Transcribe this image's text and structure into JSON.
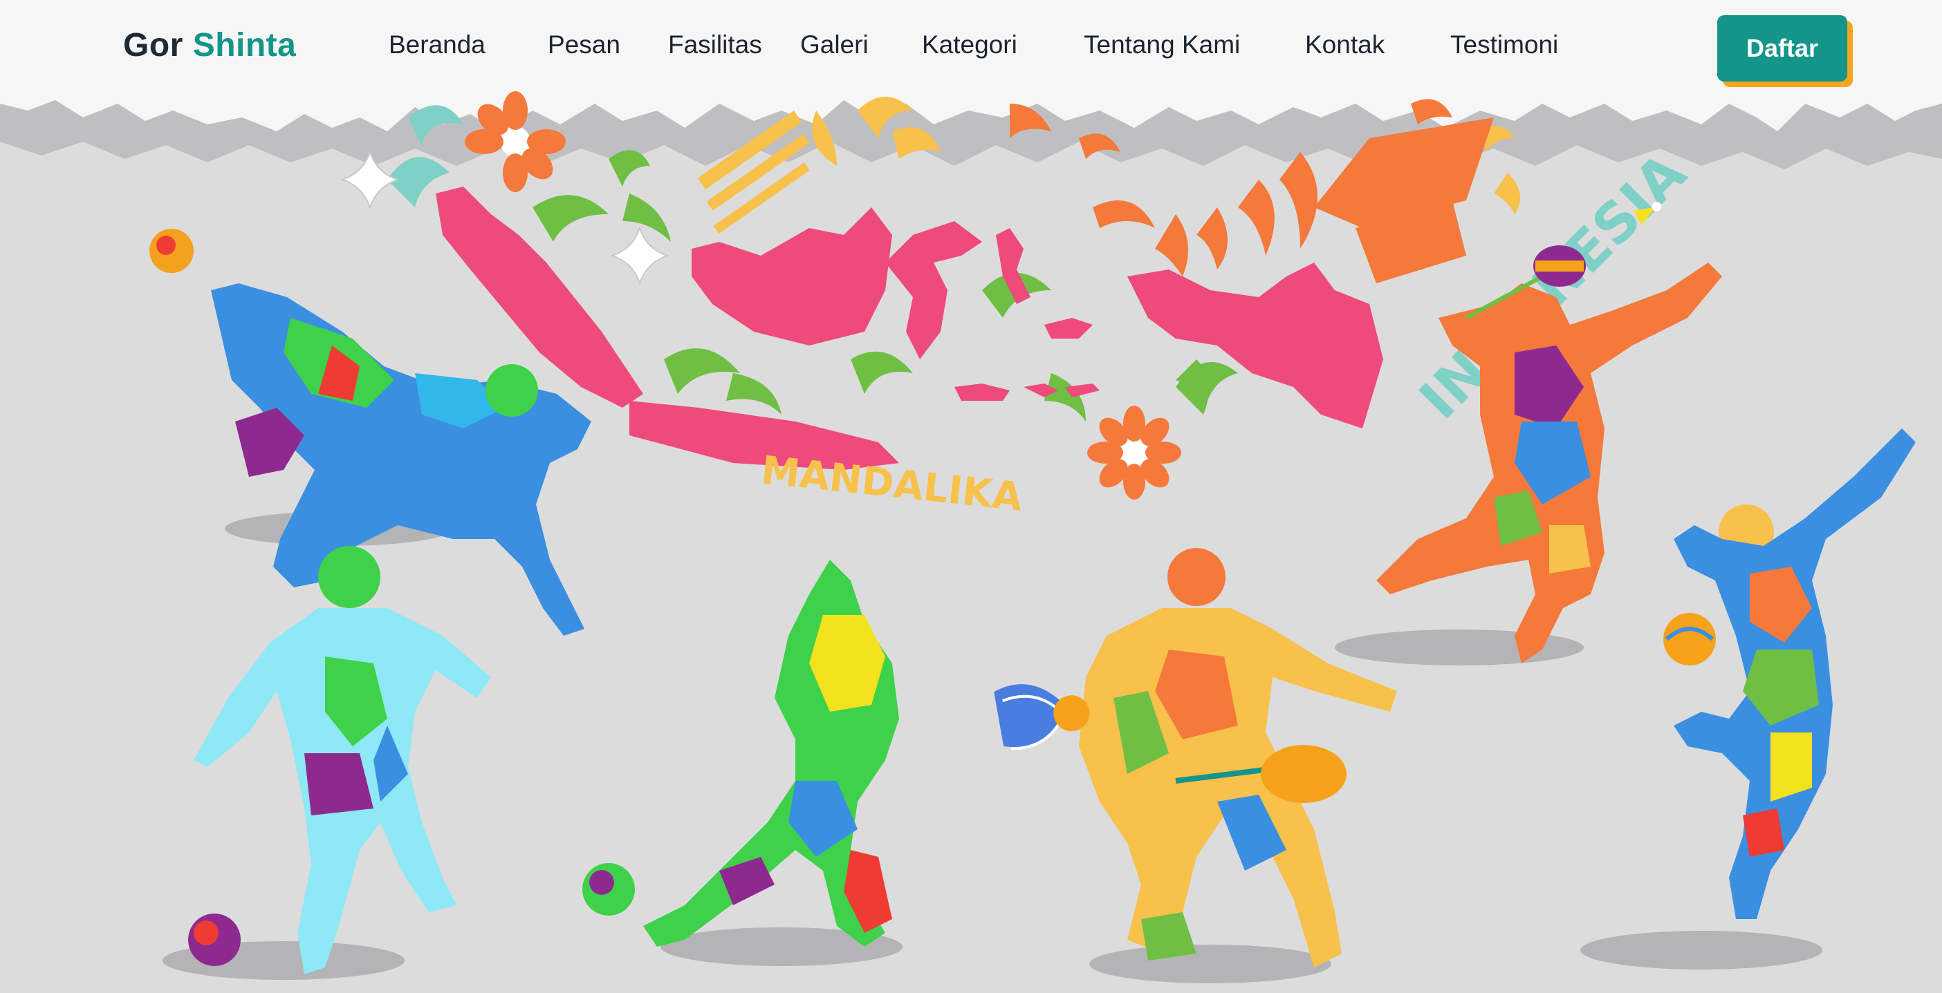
{
  "brand": {
    "first": "Gor",
    "second": "Shinta"
  },
  "nav": {
    "items": [
      {
        "id": "beranda",
        "label": "Beranda"
      },
      {
        "id": "pesan",
        "label": "Pesan"
      },
      {
        "id": "fasilitas",
        "label": "Fasilitas"
      },
      {
        "id": "galeri",
        "label": "Galeri"
      },
      {
        "id": "kategori",
        "label": "Kategori"
      },
      {
        "id": "tentang-kami",
        "label": "Tentang Kami"
      },
      {
        "id": "kontak",
        "label": "Kontak"
      },
      {
        "id": "testimoni",
        "label": "Testimoni"
      }
    ],
    "cta_label": "Daftar"
  },
  "hero": {
    "banner_text_left": "MANDALIKA",
    "banner_text_right": "INDONESIA"
  },
  "colors": {
    "accent": "#13958a",
    "cta_shadow": "#f3a51f",
    "map": "#ee4a7c",
    "background": "#dcdcdd"
  }
}
